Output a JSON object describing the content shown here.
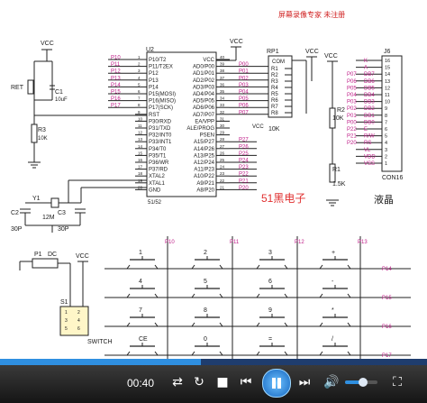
{
  "header": {
    "watermark": "屏幕录像专家 未注册"
  },
  "mcu": {
    "ref": "U2",
    "model": "51/52",
    "left_pins": [
      "P10/T2",
      "P11/T2EX",
      "P12",
      "P13",
      "P14",
      "P15(MOSI)",
      "P16(MISO)",
      "P17(SCK)",
      "RST",
      "P30/RXD",
      "P31/TXD",
      "P32/INT0",
      "P33/INT1",
      "P34/T0",
      "P35/T1",
      "P36/WR",
      "P37/RD",
      "XTAL2",
      "XTAL1",
      "GND"
    ],
    "left_nums": [
      "1",
      "2",
      "3",
      "4",
      "5",
      "6",
      "7",
      "8",
      "9",
      "10",
      "11",
      "12",
      "13",
      "14",
      "15",
      "16",
      "17",
      "18",
      "19",
      "20"
    ],
    "right_pins": [
      "VCC",
      "AD0/P00",
      "AD1/P01",
      "AD2/P02",
      "AD3/P03",
      "AD4/P04",
      "AD5/P05",
      "AD6/P06",
      "AD7/P07",
      "EA/VPP",
      "ALE/PROG",
      "PSEN",
      "A15/P27",
      "A14/P26",
      "A13/P25",
      "A12/P24",
      "A11/P23",
      "A10/P22",
      "A9/P21",
      "A8/P20"
    ],
    "right_nums": [
      "40",
      "39",
      "38",
      "37",
      "36",
      "35",
      "34",
      "33",
      "32",
      "31",
      "30",
      "29",
      "28",
      "27",
      "26",
      "25",
      "24",
      "23",
      "22",
      "21"
    ],
    "port_labels_left": [
      "P10",
      "P11",
      "P12",
      "P13",
      "P14",
      "P15",
      "P16",
      "P17"
    ],
    "port_labels_right": [
      "P00",
      "P01",
      "P02",
      "P03",
      "P04",
      "P05",
      "P06",
      "P07"
    ],
    "p2_labels": [
      "P27",
      "P26",
      "P25",
      "P24",
      "P23",
      "P22",
      "P21",
      "P20"
    ]
  },
  "power": {
    "vcc": "VCC"
  },
  "reset": {
    "label": "RET",
    "cap_ref": "C1",
    "cap_val": "10uF",
    "res_ref": "R3",
    "res_val": "10K"
  },
  "crystal": {
    "ref": "Y1",
    "val": "12M",
    "c2_ref": "C2",
    "c2_val": "30P",
    "c3_ref": "C3",
    "c3_val": "30P"
  },
  "rpack": {
    "ref": "RP1",
    "com": "COM",
    "val": "10K",
    "vcc": "VCC",
    "pins": [
      "R1",
      "R2",
      "R3",
      "R4",
      "R5",
      "R6",
      "R7",
      "R8"
    ]
  },
  "lcd": {
    "ref": "J6",
    "name": "CON16",
    "title": "液晶",
    "pin_labels": [
      "K",
      "A",
      "DB7",
      "DB6",
      "DB5",
      "DB4",
      "DB3",
      "DB2",
      "DB1",
      "DB0",
      "E",
      "R/W",
      "RS",
      "VL",
      "VDD",
      "VSS"
    ],
    "pin_nums": [
      "16",
      "15",
      "14",
      "13",
      "12",
      "11",
      "10",
      "9",
      "8",
      "7",
      "6",
      "5",
      "4",
      "3",
      "2",
      "1"
    ],
    "port_labels": [
      "P07",
      "P06",
      "P05",
      "P04",
      "P03",
      "P02",
      "P01",
      "P00",
      "P22",
      "P21",
      "P20"
    ],
    "r2_ref": "R2",
    "r2_val": "10K",
    "r1_ref": "R1",
    "r1_val": "1.5K"
  },
  "brand": {
    "label": "51黑电子"
  },
  "switch_block": {
    "p1_ref": "P1",
    "p1_label": "DC",
    "s1_ref": "S1",
    "s1_label": "SWITCH",
    "pin_labels": [
      "1",
      "2",
      "3",
      "4",
      "5",
      "6"
    ]
  },
  "keypad": {
    "col_labels": [
      "P10",
      "P11",
      "P12",
      "P13"
    ],
    "row_labels": [
      "P14",
      "P15",
      "P16",
      "P17"
    ],
    "keys": [
      "1",
      "2",
      "3",
      "+",
      "4",
      "5",
      "6",
      "-",
      "7",
      "8",
      "9",
      "*",
      "CE",
      "0",
      "=",
      "/"
    ]
  },
  "player": {
    "time": "00:40",
    "progress": 0.47,
    "volume": 0.55,
    "icons": [
      "shuffle-icon",
      "repeat-icon",
      "stop-icon",
      "previous-icon",
      "play-pause-icon",
      "next-icon",
      "volume-icon",
      "fullscreen-icon"
    ],
    "colors": {
      "accent": "#2f8fe0",
      "bar": "#1c1c1c"
    }
  }
}
